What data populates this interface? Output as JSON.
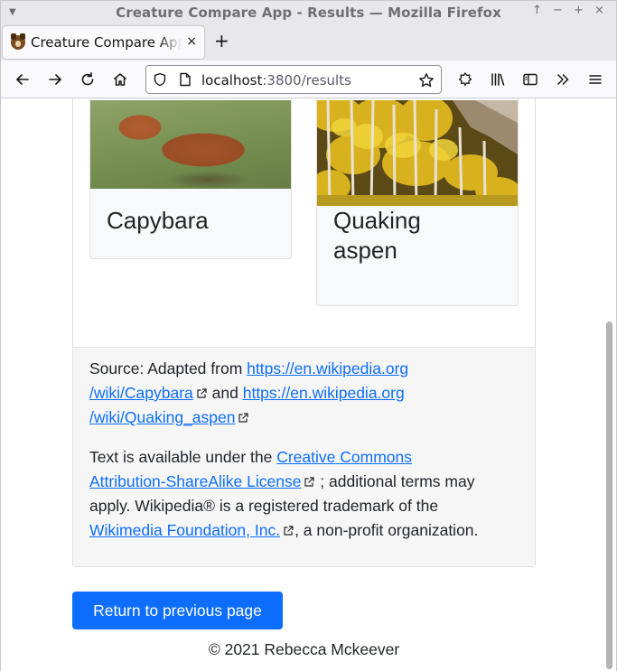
{
  "window": {
    "title": "Creature Compare App - Results — Mozilla Firefox",
    "controls": [
      "↑",
      "−",
      "+",
      "×"
    ]
  },
  "tab": {
    "title": "Creature Compare App - Results",
    "close": "×",
    "new_tab": "+"
  },
  "urlbar": {
    "host": "localhost",
    "path": ":3800/results"
  },
  "creatures": [
    {
      "name": "Capybara"
    },
    {
      "name_line1": "Quaking",
      "name_line2": "aspen"
    }
  ],
  "source": {
    "prefix": "Source: Adapted from ",
    "link1_line1": "https://en.wikipedia.org",
    "link1_line2": "/wiki/Capybara",
    "and": " and ",
    "link2_line1": "https://en.wikipedia.org",
    "link2_line2": "/wiki/Quaking_aspen"
  },
  "license": {
    "prefix": "Text is available under the ",
    "link_line1": "Creative Commons",
    "link_line2": "Attribution-ShareAlike License",
    "mid": " ; additional terms may",
    "line3": "apply. Wikipedia® is a registered trademark of the",
    "foundation_link": "Wikimedia Foundation, Inc.",
    "suffix": ", a non-profit organization."
  },
  "return_button": "Return to previous page",
  "copyright": "© 2021 Rebecca Mckeever",
  "colors": {
    "link": "#0d6efd",
    "button": "#0d6efd",
    "footer_bg": "#f6f6f7"
  }
}
